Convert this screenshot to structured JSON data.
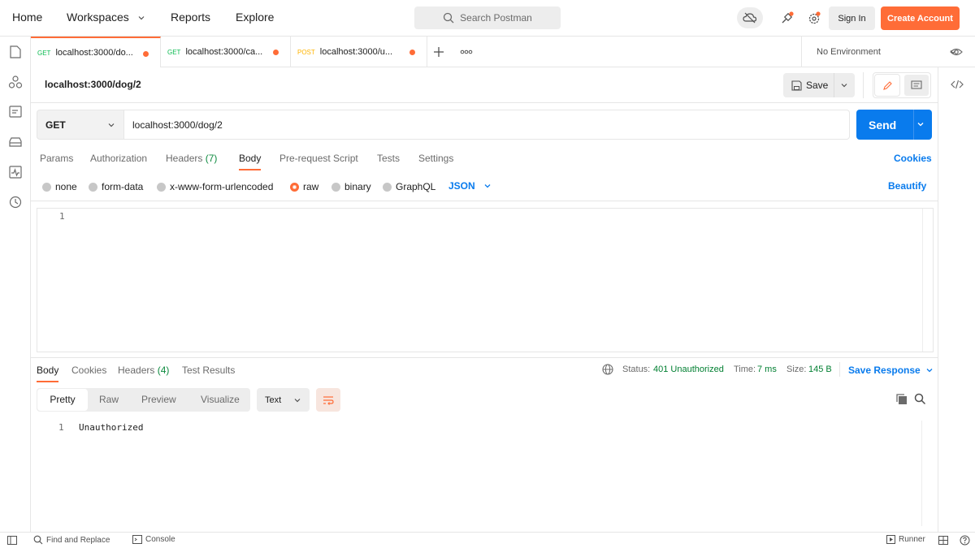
{
  "topbar": {
    "nav": [
      "Home",
      "Workspaces",
      "Reports",
      "Explore"
    ],
    "search_placeholder": "Search Postman",
    "sign_in": "Sign In",
    "create_account": "Create Account"
  },
  "tabs": [
    {
      "method": "GET",
      "label": "localhost:3000/do..."
    },
    {
      "method": "GET",
      "label": "localhost:3000/ca..."
    },
    {
      "method": "POST",
      "label": "localhost:3000/u..."
    }
  ],
  "environment": "No Environment",
  "request": {
    "name": "localhost:3000/dog/2",
    "save_label": "Save",
    "method": "GET",
    "url": "localhost:3000/dog/2",
    "send_label": "Send",
    "subtabs": [
      "Params",
      "Authorization",
      "Headers",
      "Body",
      "Pre-request Script",
      "Tests",
      "Settings"
    ],
    "headers_count": "(7)",
    "cookies": "Cookies",
    "body_types": [
      "none",
      "form-data",
      "x-www-form-urlencoded",
      "raw",
      "binary",
      "GraphQL"
    ],
    "body_format": "JSON",
    "beautify": "Beautify",
    "editor_line": "1"
  },
  "response": {
    "tabs": [
      "Body",
      "Cookies",
      "Headers",
      "Test Results"
    ],
    "headers_count": "(4)",
    "status_label": "Status:",
    "status_value": "401 Unauthorized",
    "time_label": "Time:",
    "time_value": "7 ms",
    "size_label": "Size:",
    "size_value": "145 B",
    "save_response": "Save Response",
    "views": [
      "Pretty",
      "Raw",
      "Preview",
      "Visualize"
    ],
    "format": "Text",
    "line_number": "1",
    "body_text": "Unauthorized"
  },
  "statusbar": {
    "find_replace": "Find and Replace",
    "console": "Console",
    "runner": "Runner"
  },
  "colors": {
    "accent": "#ff6c37",
    "send_blue": "#097bed",
    "get_green": "#0cbb52",
    "post_yellow": "#ffb400",
    "status_green": "#007f31"
  }
}
